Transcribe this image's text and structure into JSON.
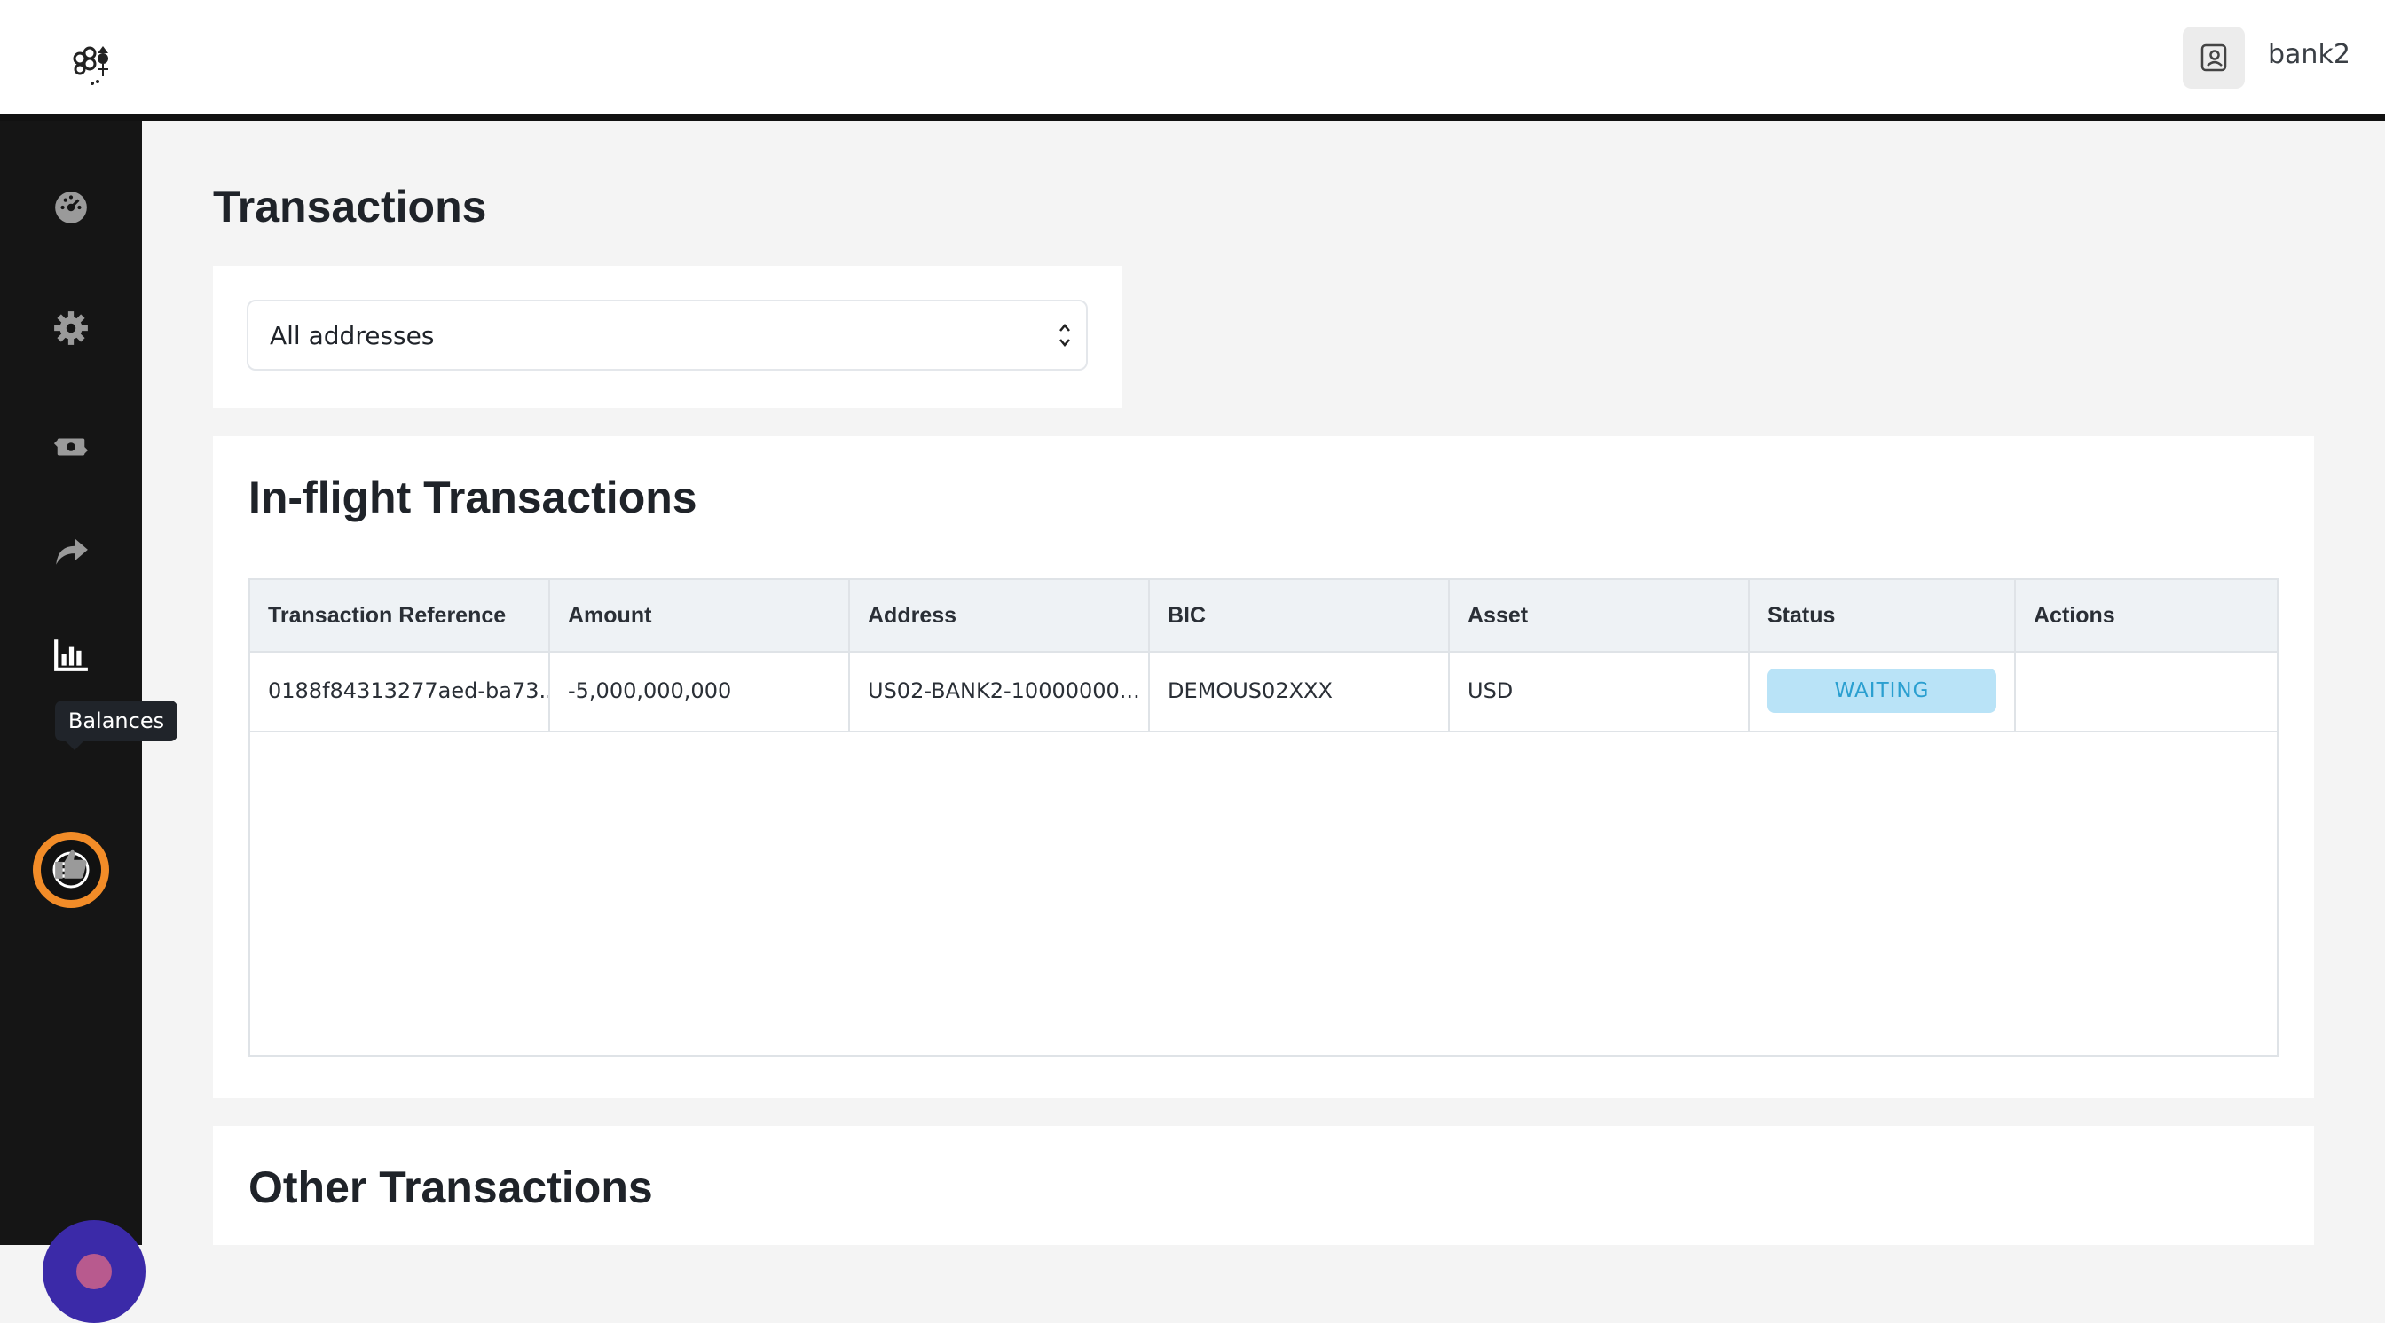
{
  "header": {
    "username": "bank2"
  },
  "sidebar": {
    "tooltip": "Balances",
    "items": [
      {
        "icon": "dashboard-icon"
      },
      {
        "icon": "gear-icon"
      },
      {
        "icon": "money-exchange-icon"
      },
      {
        "icon": "share-arrow-icon"
      },
      {
        "icon": "bar-chart-icon"
      },
      {
        "icon": "list-menu-icon",
        "active": true
      },
      {
        "icon": "thumbs-up-icon"
      }
    ],
    "accent_color": "#f28c28"
  },
  "main": {
    "title": "Transactions",
    "filter": {
      "selected": "All addresses"
    },
    "inflight": {
      "title": "In-flight Transactions",
      "columns": [
        "Transaction Reference",
        "Amount",
        "Address",
        "BIC",
        "Asset",
        "Status",
        "Actions"
      ],
      "rows": [
        {
          "reference": "0188f84313277aed-ba73...",
          "amount": "-5,000,000,000",
          "address": "US02-BANK2-10000000...",
          "bic": "DEMOUS02XXX",
          "asset": "USD",
          "status": "WAITING",
          "actions": ""
        }
      ]
    },
    "other": {
      "title": "Other Transactions"
    }
  }
}
